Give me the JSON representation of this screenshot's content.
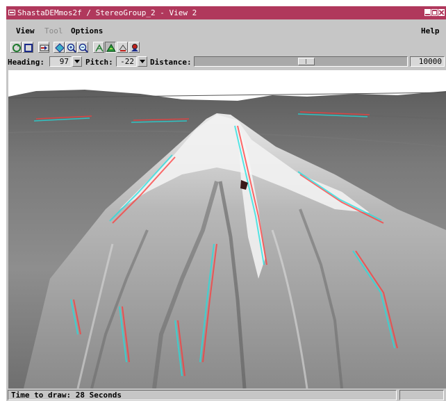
{
  "window": {
    "title": "ShastaDEMmos2f / StereoGroup_2 - View 2",
    "accent_color": "#b0385c"
  },
  "menubar": {
    "view": "View",
    "tool": "Tool",
    "options": "Options",
    "help": "Help"
  },
  "toolbar": {
    "icons": [
      "redraw-icon",
      "full-view-icon",
      "zoom-extent-icon",
      "fit-icon",
      "zoom-in-icon",
      "zoom-out-icon",
      "move-viewer-icon",
      "move-scene-icon",
      "fly-icon",
      "stereo-icon"
    ]
  },
  "controls": {
    "heading_label": "Heading:",
    "heading_value": "97",
    "pitch_label": "Pitch:",
    "pitch_value": "-22",
    "distance_label": "Distance:",
    "distance_value": "10000",
    "distance_slider_fraction": 0.53
  },
  "status": {
    "text": "Time to draw: 28 Seconds"
  }
}
